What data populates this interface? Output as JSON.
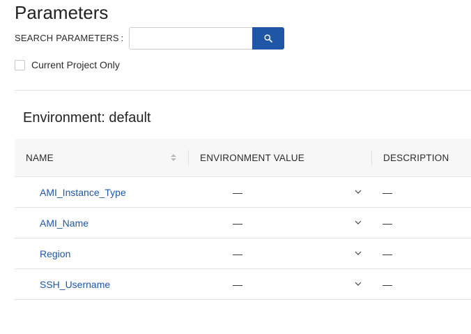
{
  "page": {
    "title": "Parameters"
  },
  "search": {
    "label": "SEARCH PARAMETERS :",
    "value": "",
    "placeholder": ""
  },
  "filter": {
    "current_project_only_label": "Current Project Only",
    "current_project_only_checked": false
  },
  "environment": {
    "heading": "Environment: default"
  },
  "table": {
    "columns": {
      "name": "NAME",
      "environment_value": "ENVIRONMENT VALUE",
      "description": "DESCRIPTION"
    },
    "rows": [
      {
        "name": "AMI_Instance_Type",
        "environment_value": "—",
        "description": "—"
      },
      {
        "name": "AMI_Name",
        "environment_value": "—",
        "description": "—"
      },
      {
        "name": "Region",
        "environment_value": "—",
        "description": "—"
      },
      {
        "name": "SSH_Username",
        "environment_value": "—",
        "description": "—"
      }
    ]
  },
  "icons": {
    "search_button": "search-icon",
    "sort": "sort-icon",
    "row_expand": "chevron-down-icon"
  },
  "colors": {
    "accent": "#1f56a6",
    "link": "#1f56a6",
    "header_bg": "#f7f7f7",
    "divider": "#e4e4e4"
  }
}
